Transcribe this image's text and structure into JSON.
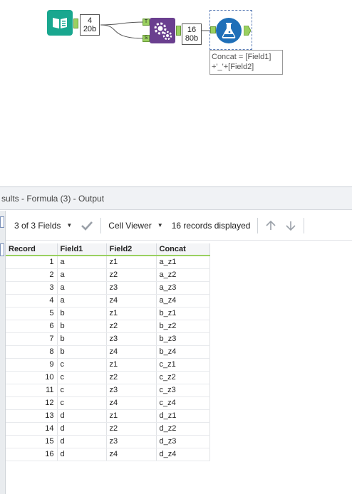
{
  "canvas": {
    "input_count": {
      "records": "4",
      "size": "20b"
    },
    "append_anchors": {
      "target": "T",
      "source": "S"
    },
    "append_count": {
      "records": "16",
      "size": "80b"
    },
    "formula_annotation": {
      "line1": "Concat = [Field1]",
      "line2": "+'_'+[Field2]"
    },
    "colors": {
      "input_tool": "#19a78f",
      "append_tool": "#6a3f8f",
      "formula_tool": "#1f6fb8",
      "anchor": "#9ad060"
    }
  },
  "results": {
    "title": "sults - Formula (3) - Output",
    "toolbar": {
      "fields_selector": "3 of 3 Fields",
      "cell_viewer": "Cell Viewer",
      "records_displayed": "16 records displayed"
    },
    "columns": [
      "Record",
      "Field1",
      "Field2",
      "Concat"
    ],
    "rows": [
      [
        "1",
        "a",
        "z1",
        "a_z1"
      ],
      [
        "2",
        "a",
        "z2",
        "a_z2"
      ],
      [
        "3",
        "a",
        "z3",
        "a_z3"
      ],
      [
        "4",
        "a",
        "z4",
        "a_z4"
      ],
      [
        "5",
        "b",
        "z1",
        "b_z1"
      ],
      [
        "6",
        "b",
        "z2",
        "b_z2"
      ],
      [
        "7",
        "b",
        "z3",
        "b_z3"
      ],
      [
        "8",
        "b",
        "z4",
        "b_z4"
      ],
      [
        "9",
        "c",
        "z1",
        "c_z1"
      ],
      [
        "10",
        "c",
        "z2",
        "c_z2"
      ],
      [
        "11",
        "c",
        "z3",
        "c_z3"
      ],
      [
        "12",
        "c",
        "z4",
        "c_z4"
      ],
      [
        "13",
        "d",
        "z1",
        "d_z1"
      ],
      [
        "14",
        "d",
        "z2",
        "d_z2"
      ],
      [
        "15",
        "d",
        "z3",
        "d_z3"
      ],
      [
        "16",
        "d",
        "z4",
        "d_z4"
      ]
    ]
  }
}
